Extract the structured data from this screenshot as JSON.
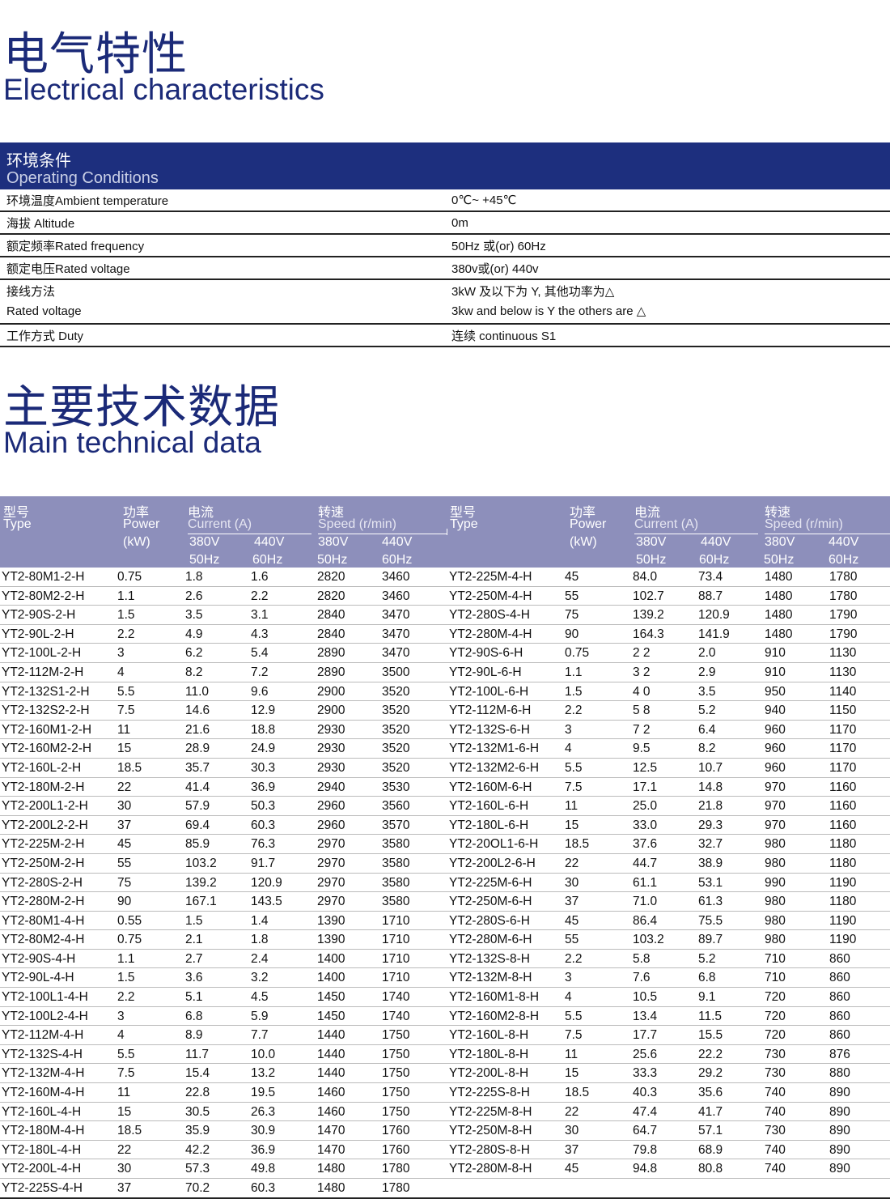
{
  "section1": {
    "title_zh": "电气特性",
    "title_en": "Electrical  characteristics"
  },
  "conditions": {
    "header_zh": "环境条件",
    "header_en": "Operating Conditions",
    "rows": [
      {
        "k": "环境温度Ambient temperature",
        "v": "0℃~  +45℃"
      },
      {
        "k": "海拔  Altitude",
        "v": "0m"
      },
      {
        "k": "额定频率Rated frequency",
        "v": "50Hz 或(or)  60Hz"
      },
      {
        "k": "额定电压Rated voltage",
        "v": "380v或(or) 440v"
      },
      {
        "k": "接线方法",
        "k2": "Rated voltage",
        "v": "3kW 及以下为 Y, 其他功率为△",
        "v2": "3kw and  below is Y  the others are  △"
      },
      {
        "k": "工作方式  Duty",
        "v": "连续  continuous  S1"
      }
    ]
  },
  "section2": {
    "title_zh": "主要技术数据",
    "title_en": "Main technical  data"
  },
  "table": {
    "header": {
      "type_zh": "型号",
      "type_en": "Type",
      "power_zh": "功率",
      "power_en": "Power",
      "power_unit": "(kW)",
      "current_zh": "电流",
      "current_en": "Current (A)",
      "speed_zh": "转速",
      "speed_en": "Speed (r/min)",
      "v380": "380V",
      "v440": "440V",
      "f50": "50Hz",
      "f60": "60Hz"
    },
    "rows": [
      [
        [
          "YT2-80M1-2-H",
          "0.75",
          "1.8",
          "1.6",
          "2820",
          "3460"
        ],
        [
          "YT2-225M-4-H",
          "45",
          "84.0",
          "73.4",
          "1480",
          "1780"
        ]
      ],
      [
        [
          "YT2-80M2-2-H",
          "1.1",
          "2.6",
          "2.2",
          "2820",
          "3460"
        ],
        [
          "YT2-250M-4-H",
          "55",
          "102.7",
          "88.7",
          "1480",
          "1780"
        ]
      ],
      [
        [
          "YT2-90S-2-H",
          "1.5",
          "3.5",
          "3.1",
          "2840",
          "3470"
        ],
        [
          "YT2-280S-4-H",
          "75",
          "139.2",
          "120.9",
          "1480",
          "1790"
        ]
      ],
      [
        [
          "YT2-90L-2-H",
          "2.2",
          "4.9",
          "4.3",
          "2840",
          "3470"
        ],
        [
          "YT2-280M-4-H",
          "90",
          "164.3",
          "141.9",
          "1480",
          "1790"
        ]
      ],
      [
        [
          "YT2-100L-2-H",
          "3",
          "6.2",
          "5.4",
          "2890",
          "3470"
        ],
        [
          "YT2-90S-6-H",
          "0.75",
          "2 2",
          "2.0",
          "910",
          "1130"
        ]
      ],
      [
        [
          "YT2-112M-2-H",
          "4",
          "8.2",
          "7.2",
          "2890",
          "3500"
        ],
        [
          "YT2-90L-6-H",
          "1.1",
          "3 2",
          "2.9",
          "910",
          "1130"
        ]
      ],
      [
        [
          "YT2-132S1-2-H",
          "5.5",
          "11.0",
          "9.6",
          "2900",
          "3520"
        ],
        [
          "YT2-100L-6-H",
          "1.5",
          "4 0",
          "3.5",
          "950",
          "1140"
        ]
      ],
      [
        [
          "YT2-132S2-2-H",
          "7.5",
          "14.6",
          "12.9",
          "2900",
          "3520"
        ],
        [
          "YT2-112M-6-H",
          "2.2",
          "5 8",
          "5.2",
          "940",
          "1150"
        ]
      ],
      [
        [
          "YT2-160M1-2-H",
          "11",
          "21.6",
          "18.8",
          "2930",
          "3520"
        ],
        [
          "YT2-132S-6-H",
          "3",
          "7 2",
          "6.4",
          "960",
          "1170"
        ]
      ],
      [
        [
          "YT2-160M2-2-H",
          "15",
          "28.9",
          "24.9",
          "2930",
          "3520"
        ],
        [
          "YT2-132M1-6-H",
          "4",
          "9.5",
          "8.2",
          "960",
          "1170"
        ]
      ],
      [
        [
          "YT2-160L-2-H",
          "18.5",
          "35.7",
          "30.3",
          "2930",
          "3520"
        ],
        [
          "YT2-132M2-6-H",
          "5.5",
          "12.5",
          "10.7",
          "960",
          "1170"
        ]
      ],
      [
        [
          "YT2-180M-2-H",
          "22",
          "41.4",
          "36.9",
          "2940",
          "3530"
        ],
        [
          "YT2-160M-6-H",
          "7.5",
          "17.1",
          "14.8",
          "970",
          "1160"
        ]
      ],
      [
        [
          "YT2-200L1-2-H",
          "30",
          "57.9",
          "50.3",
          "2960",
          "3560"
        ],
        [
          "YT2-160L-6-H",
          "11",
          "25.0",
          "21.8",
          "970",
          "1160"
        ]
      ],
      [
        [
          "YT2-200L2-2-H",
          "37",
          "69.4",
          "60.3",
          "2960",
          "3570"
        ],
        [
          "YT2-180L-6-H",
          "15",
          "33.0",
          "29.3",
          "970",
          "1160"
        ]
      ],
      [
        [
          "YT2-225M-2-H",
          "45",
          "85.9",
          "76.3",
          "2970",
          "3580"
        ],
        [
          "YT2-20OL1-6-H",
          "18.5",
          "37.6",
          "32.7",
          "980",
          "1180"
        ]
      ],
      [
        [
          "YT2-250M-2-H",
          "55",
          "103.2",
          "91.7",
          "2970",
          "3580"
        ],
        [
          "YT2-200L2-6-H",
          "22",
          "44.7",
          "38.9",
          "980",
          "1180"
        ]
      ],
      [
        [
          "YT2-280S-2-H",
          "75",
          "139.2",
          "120.9",
          "2970",
          "3580"
        ],
        [
          "YT2-225M-6-H",
          "30",
          "61.1",
          "53.1",
          "990",
          "1190"
        ]
      ],
      [
        [
          "YT2-280M-2-H",
          "90",
          "167.1",
          "143.5",
          "2970",
          "3580"
        ],
        [
          "YT2-250M-6-H",
          "37",
          "71.0",
          "61.3",
          "980",
          "1180"
        ]
      ],
      [
        [
          "YT2-80M1-4-H",
          "0.55",
          "1.5",
          "1.4",
          "1390",
          "1710"
        ],
        [
          "YT2-280S-6-H",
          "45",
          "86.4",
          "75.5",
          "980",
          "1190"
        ]
      ],
      [
        [
          "YT2-80M2-4-H",
          "0.75",
          "2.1",
          "1.8",
          "1390",
          "1710"
        ],
        [
          "YT2-280M-6-H",
          "55",
          "103.2",
          "89.7",
          "980",
          "1190"
        ]
      ],
      [
        [
          "YT2-90S-4-H",
          "1.1",
          "2.7",
          "2.4",
          "1400",
          "1710"
        ],
        [
          "YT2-132S-8-H",
          "2.2",
          "5.8",
          "5.2",
          "710",
          "860"
        ]
      ],
      [
        [
          "YT2-90L-4-H",
          "1.5",
          "3.6",
          "3.2",
          "1400",
          "1710"
        ],
        [
          "YT2-132M-8-H",
          "3",
          "7.6",
          "6.8",
          "710",
          "860"
        ]
      ],
      [
        [
          "YT2-100L1-4-H",
          "2.2",
          "5.1",
          "4.5",
          "1450",
          "1740"
        ],
        [
          "YT2-160M1-8-H",
          "4",
          "10.5",
          "9.1",
          "720",
          "860"
        ]
      ],
      [
        [
          "YT2-100L2-4-H",
          "3",
          "6.8",
          "5.9",
          "1450",
          "1740"
        ],
        [
          "YT2-160M2-8-H",
          "5.5",
          "13.4",
          "11.5",
          "720",
          "860"
        ]
      ],
      [
        [
          "YT2-112M-4-H",
          "4",
          "8.9",
          "7.7",
          "1440",
          "1750"
        ],
        [
          "YT2-160L-8-H",
          "7.5",
          "17.7",
          "15.5",
          "720",
          "860"
        ]
      ],
      [
        [
          "YT2-132S-4-H",
          "5.5",
          "11.7",
          "10.0",
          "1440",
          "1750"
        ],
        [
          "YT2-180L-8-H",
          "11",
          "25.6",
          "22.2",
          "730",
          "876"
        ]
      ],
      [
        [
          "YT2-132M-4-H",
          "7.5",
          "15.4",
          "13.2",
          "1440",
          "1750"
        ],
        [
          "YT2-200L-8-H",
          "15",
          "33.3",
          "29.2",
          "730",
          "880"
        ]
      ],
      [
        [
          "YT2-160M-4-H",
          "11",
          "22.8",
          "19.5",
          "1460",
          "1750"
        ],
        [
          "YT2-225S-8-H",
          "18.5",
          "40.3",
          "35.6",
          "740",
          "890"
        ]
      ],
      [
        [
          "YT2-160L-4-H",
          "15",
          "30.5",
          "26.3",
          "1460",
          "1750"
        ],
        [
          "YT2-225M-8-H",
          "22",
          "47.4",
          "41.7",
          "740",
          "890"
        ]
      ],
      [
        [
          "YT2-180M-4-H",
          "18.5",
          "35.9",
          "30.9",
          "1470",
          "1760"
        ],
        [
          "YT2-250M-8-H",
          "30",
          "64.7",
          "57.1",
          "730",
          "890"
        ]
      ],
      [
        [
          "YT2-180L-4-H",
          "22",
          "42.2",
          "36.9",
          "1470",
          "1760"
        ],
        [
          "YT2-280S-8-H",
          "37",
          "79.8",
          "68.9",
          "740",
          "890"
        ]
      ],
      [
        [
          "YT2-200L-4-H",
          "30",
          "57.3",
          "49.8",
          "1480",
          "1780"
        ],
        [
          "YT2-280M-8-H",
          "45",
          "94.8",
          "80.8",
          "740",
          "890"
        ]
      ],
      [
        [
          "YT2-225S-4-H",
          "37",
          "70.2",
          "60.3",
          "1480",
          "1780"
        ],
        [
          "",
          "",
          "",
          "",
          "",
          ""
        ]
      ]
    ]
  }
}
